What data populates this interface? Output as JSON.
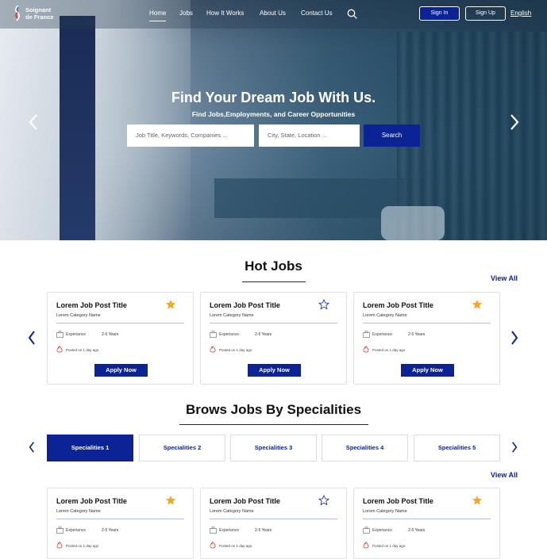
{
  "brand": {
    "line1": "Soignant",
    "line2": "de France"
  },
  "nav": {
    "links": [
      "Home",
      "Jobs",
      "How It Works",
      "About Us",
      "Contact Us"
    ],
    "signin": "Sign In",
    "signup": "Sign Up",
    "language": "English"
  },
  "hero": {
    "title": "Find Your Dream Job With Us.",
    "subtitle": "Find Jobs,Employments, and Career Opportunities",
    "keyword_placeholder": "Job Title, Keywords, Companies ...",
    "location_placeholder": "City, State, Location ...",
    "search_button": "Search"
  },
  "hot_jobs": {
    "title": "Hot Jobs",
    "view_all": "View All",
    "cards": [
      {
        "title": "Lorem Job Post Title",
        "category": "Lorem Category Name",
        "experience_label": "Experiance",
        "experience_value": "2-5 Years",
        "posted": "Posted on 1 day ago",
        "apply": "Apply Now",
        "starred": true
      },
      {
        "title": "Lorem Job Post Title",
        "category": "Lorem Category Name",
        "experience_label": "Experiance",
        "experience_value": "2-5 Years",
        "posted": "Posted on 1 day ago",
        "apply": "Apply Now",
        "starred": false
      },
      {
        "title": "Lorem Job Post Title",
        "category": "Lorem Category Name",
        "experience_label": "Experiance",
        "experience_value": "2-5 Years",
        "posted": "Posted on 1 day ago",
        "apply": "Apply Now",
        "starred": true
      }
    ]
  },
  "specialities": {
    "title": "Brows Jobs By Specialities",
    "tabs": [
      "Specialities 1",
      "Specialities 2",
      "Specialities 3",
      "Specialities 4",
      "Specialities 5"
    ],
    "active_tab": 0,
    "view_all": "View All",
    "cards": [
      {
        "title": "Lorem Job Post Title",
        "category": "Lorem Category Name",
        "experience_label": "Experiance",
        "experience_value": "2-5 Years",
        "posted": "Posted on 1 day ago",
        "starred": true
      },
      {
        "title": "Lorem Job Post Title",
        "category": "Lorem Category Name",
        "experience_label": "Experiance",
        "experience_value": "2-5 Years",
        "posted": "Posted on 1 day ago",
        "starred": false
      },
      {
        "title": "Lorem Job Post Title",
        "category": "Lorem Category Name",
        "experience_label": "Experiance",
        "experience_value": "2-5 Years",
        "posted": "Posted on 1 day ago",
        "starred": true
      }
    ]
  },
  "colors": {
    "primary": "#0b2394",
    "star": "#f5a623",
    "border": "#e1e1e1"
  },
  "icons": [
    "logo-mark",
    "search-icon",
    "chevron-left-icon",
    "chevron-right-icon",
    "star-icon",
    "briefcase-icon",
    "flame-icon"
  ]
}
